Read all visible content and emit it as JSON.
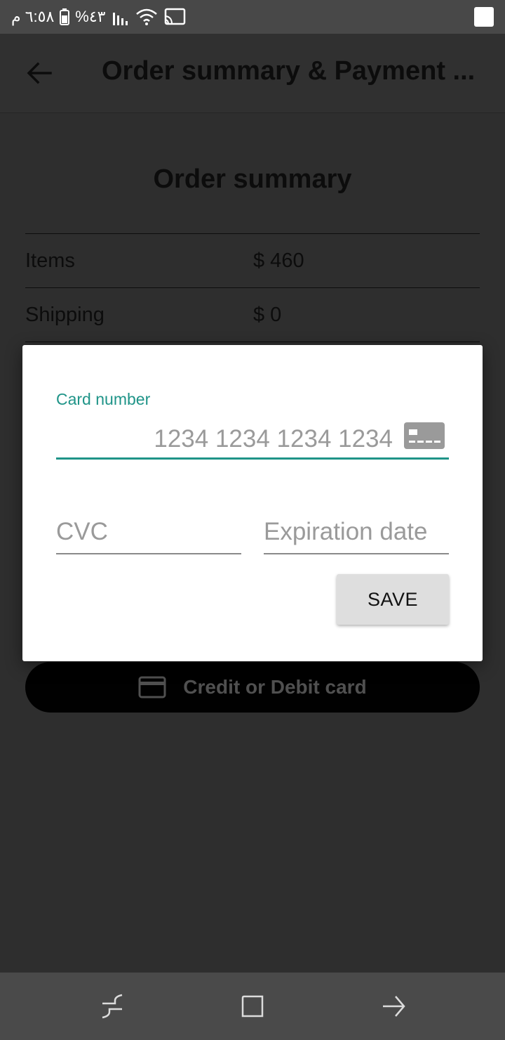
{
  "status_bar": {
    "time": "٦:٥٨ م",
    "battery": "%٤٣"
  },
  "app_bar": {
    "title": "Order summary & Payment ..."
  },
  "summary": {
    "title": "Order summary",
    "rows": [
      {
        "label": "Items",
        "value": "$ 460"
      },
      {
        "label": "Shipping",
        "value": "$ 0"
      }
    ]
  },
  "payment_button": {
    "label": "Credit or Debit card"
  },
  "dialog": {
    "card_label": "Card number",
    "card_placeholder": "1234 1234 1234 1234",
    "cvc_placeholder": "CVC",
    "expiration_placeholder": "Expiration date",
    "save_label": "SAVE"
  },
  "colors": {
    "accent": "#1f9488",
    "background": "#2e2e2e",
    "dialog": "#ffffff"
  }
}
